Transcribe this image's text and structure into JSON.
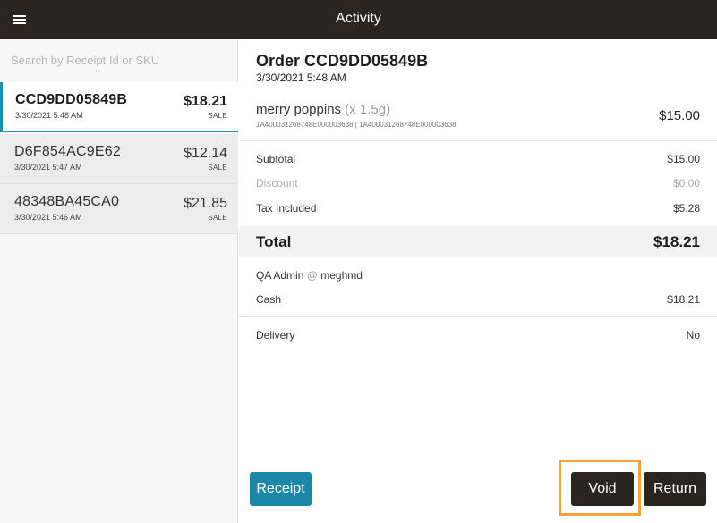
{
  "header": {
    "title": "Activity",
    "menu_icon": "hamburger-menu-icon"
  },
  "search": {
    "placeholder": "Search by Receipt Id or SKU"
  },
  "orders": [
    {
      "id": "CCD9DD05849B",
      "date": "3/30/2021 5:48 AM",
      "amount": "$18.21",
      "type": "SALE",
      "selected": true
    },
    {
      "id": "D6F854AC9E62",
      "date": "3/30/2021 5:47 AM",
      "amount": "$12.14",
      "type": "SALE",
      "selected": false
    },
    {
      "id": "48348BA45CA0",
      "date": "3/30/2021 5:46 AM",
      "amount": "$21.85",
      "type": "SALE",
      "selected": false
    }
  ],
  "detail": {
    "title": "Order CCD9DD05849B",
    "datetime": "3/30/2021 5:48 AM",
    "item": {
      "name": "merry poppins",
      "qty": "(x 1.5g)",
      "sku": "1A400031268748E000003638 | 1A400031268748E000003638",
      "price": "$15.00"
    },
    "subtotal": {
      "label": "Subtotal",
      "value": "$15.00"
    },
    "discount": {
      "label": "Discount",
      "value": "$0.00"
    },
    "tax": {
      "label": "Tax Included",
      "value": "$5.28"
    },
    "total": {
      "label": "Total",
      "value": "$18.21"
    },
    "employee": {
      "label": "QA Admin",
      "at": "@",
      "location": "meghmd"
    },
    "payment": {
      "label": "Cash",
      "value": "$18.21"
    },
    "delivery": {
      "label": "Delivery",
      "value": "No"
    }
  },
  "actions": {
    "receipt": "Receipt",
    "void": "Void",
    "return": "Return"
  },
  "colors": {
    "topbar": "#2a2521",
    "accent": "#1a87a8",
    "highlight": "#f5a23a"
  }
}
